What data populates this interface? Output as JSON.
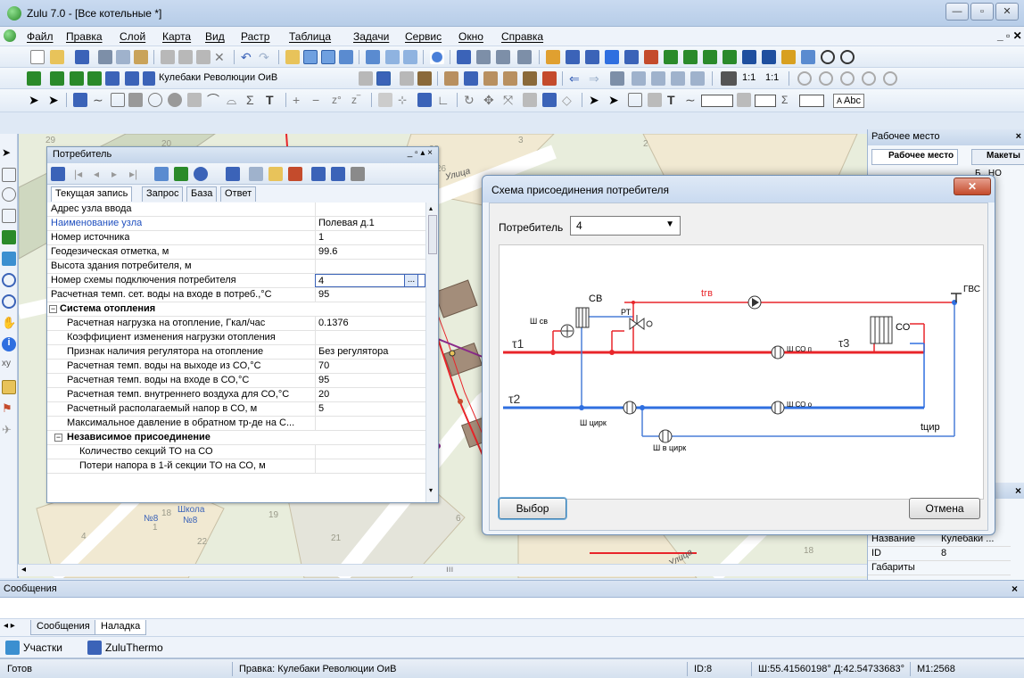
{
  "window": {
    "title": "Zulu 7.0 - [Все котельные *]"
  },
  "menu": [
    "Файл",
    "Правка",
    "Слой",
    "Карта",
    "Вид",
    "Растр",
    "Таблица",
    "Задачи",
    "Сервис",
    "Окно",
    "Справка"
  ],
  "toolbar3": {
    "layer_name": "Кулебаки Революции ОиВ",
    "scale_a": "1:1",
    "scale_b": "1:1"
  },
  "toolbar4": {
    "text_tool": "Abc"
  },
  "map_labels": {
    "street1": "Улица",
    "street2": "Улица",
    "school": "Школа",
    "school_no": "№8",
    "house_no": "№8"
  },
  "consumer_panel": {
    "title": "Потребитель",
    "tabs": [
      "Текущая запись",
      "Запрос",
      "База",
      "Ответ"
    ],
    "rows": [
      {
        "name": "Адрес узла ввода",
        "value": ""
      },
      {
        "name": "Наименование узла",
        "value": "Полевая д.1"
      },
      {
        "name": "Номер источника",
        "value": "1"
      },
      {
        "name": "Геодезическая отметка, м",
        "value": "99.6"
      },
      {
        "name": "Высота здания потребителя, м",
        "value": ""
      },
      {
        "name": "Номер схемы подключения потребителя",
        "value": "4"
      },
      {
        "name": "Расчетная темп. сет. воды на входе в потреб.,°С",
        "value": "95"
      },
      {
        "name": "Система отопления",
        "value": "",
        "group": true
      },
      {
        "name": "Расчетная нагрузка на отопление, Гкал/час",
        "value": "0.1376"
      },
      {
        "name": "Коэффициент изменения нагрузки отопления",
        "value": ""
      },
      {
        "name": "Признак наличия регулятора на отопление",
        "value": "Без регулятора"
      },
      {
        "name": "Расчетная темп. воды на выходе из СО,°С",
        "value": "70"
      },
      {
        "name": "Расчетная темп. воды на входе в СО,°С",
        "value": "95"
      },
      {
        "name": "Расчетная темп. внутреннего воздуха для СО,°С",
        "value": "20"
      },
      {
        "name": "Расчетный располагаемый напор в СО, м",
        "value": "5"
      },
      {
        "name": "Максимальное давление в обратном тр-де на С...",
        "value": ""
      },
      {
        "name": "Независимое присоединение",
        "value": "",
        "group": true
      },
      {
        "name": "Количество секций ТО на СО",
        "value": ""
      },
      {
        "name": "Потери напора в 1-й секции ТО на СО, м",
        "value": ""
      }
    ]
  },
  "dialog": {
    "title": "Схема присоединения потребителя",
    "consumer_label": "Потребитель",
    "consumer_value": "4",
    "ok_label": "Выбор",
    "cancel_label": "Отмена",
    "scheme": {
      "cv": "СВ",
      "w_cv": "Ш св",
      "rt": "РТ",
      "tgv": "tгв",
      "gvs": "ГВС",
      "co": "СО",
      "t1": "τ1",
      "t2": "τ2",
      "t3": "τ3",
      "w_co_p": "Ш СО п",
      "w_co_o": "Ш СО о",
      "w_circ": "Ш цирк",
      "w_v_circ": "Ш в цирк",
      "tcir": "tцир"
    }
  },
  "right_panel": {
    "title": "Рабочее место",
    "tab1": "Рабочее место",
    "tab2": "Макеты",
    "tree_item": "Б...НО",
    "props": [
      {
        "name": "Название",
        "value": "Кулебаки ..."
      },
      {
        "name": "ID",
        "value": "8"
      },
      {
        "name": "Габариты",
        "value": ""
      }
    ]
  },
  "messages": {
    "title": "Сообщения",
    "tabs": [
      "Сообщения",
      "Наладка"
    ]
  },
  "area_tabs": [
    "Участки",
    "ZuluThermo"
  ],
  "status": {
    "ready": "Готов",
    "edit": "Правка: Кулебаки Революции ОиВ",
    "id": "ID:8",
    "coords": "Ш:55.41560198° Д:42.54733683°",
    "scale": "M1:2568"
  },
  "colors": {
    "supply": "#e8252a",
    "return": "#2f6fe0",
    "circulation": "#4a7fd8"
  }
}
